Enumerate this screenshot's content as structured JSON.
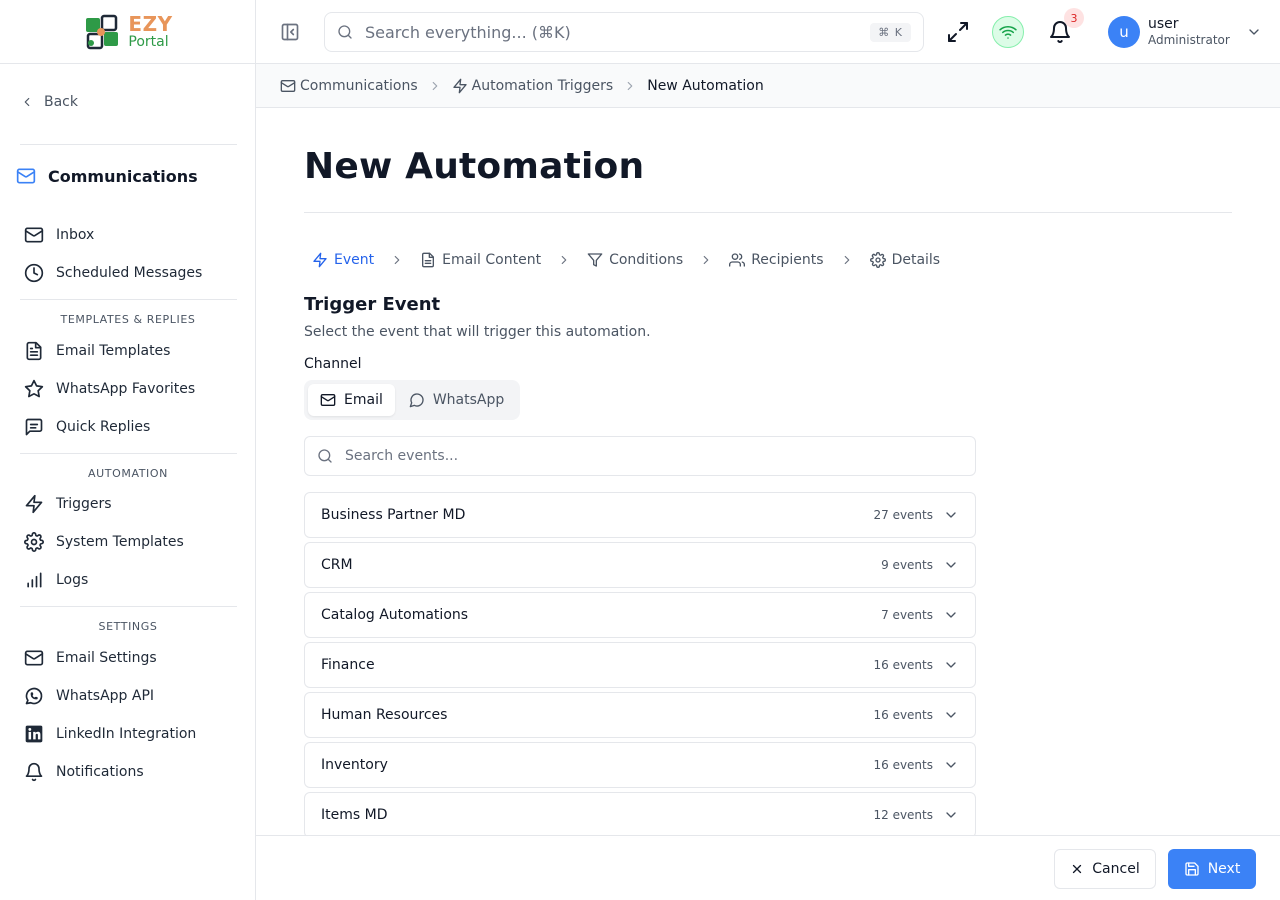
{
  "brand": {
    "name_top": "EZY",
    "name_bottom": "Portal"
  },
  "colors": {
    "accent": "#3b82f6",
    "active_step": "#2563eb",
    "logo_orange": "#e8955a",
    "logo_green": "#2e9a47",
    "status_green": "#22c55e",
    "badge_red": "#dc2626"
  },
  "sidebar": {
    "back_label": "Back",
    "section_title": "Communications",
    "items": [
      {
        "label": "Inbox",
        "icon": "mail-icon"
      },
      {
        "label": "Scheduled Messages",
        "icon": "clock-icon"
      }
    ],
    "groups": [
      {
        "label": "TEMPLATES & REPLIES",
        "items": [
          {
            "label": "Email Templates",
            "icon": "file-text-icon"
          },
          {
            "label": "WhatsApp Favorites",
            "icon": "star-icon"
          },
          {
            "label": "Quick Replies",
            "icon": "message-square-icon"
          }
        ]
      },
      {
        "label": "AUTOMATION",
        "items": [
          {
            "label": "Triggers",
            "icon": "zap-icon"
          },
          {
            "label": "System Templates",
            "icon": "gear-icon"
          },
          {
            "label": "Logs",
            "icon": "bar-chart-icon"
          }
        ]
      },
      {
        "label": "SETTINGS",
        "items": [
          {
            "label": "Email Settings",
            "icon": "mail-icon"
          },
          {
            "label": "WhatsApp API",
            "icon": "whatsapp-icon"
          },
          {
            "label": "LinkedIn Integration",
            "icon": "linkedin-icon"
          },
          {
            "label": "Notifications",
            "icon": "bell-icon"
          }
        ]
      }
    ]
  },
  "header": {
    "search_placeholder": "Search everything... (⌘K)",
    "search_shortcut": "⌘ K",
    "notification_count": "3",
    "user": {
      "initial": "u",
      "name": "user",
      "role": "Administrator"
    }
  },
  "breadcrumb": [
    {
      "label": "Communications",
      "icon": "mail-icon"
    },
    {
      "label": "Automation Triggers",
      "icon": "zap-icon"
    },
    {
      "label": "New Automation"
    }
  ],
  "page": {
    "title": "New Automation",
    "steps": [
      {
        "label": "Event",
        "icon": "zap-icon",
        "active": true
      },
      {
        "label": "Email Content",
        "icon": "file-text-icon"
      },
      {
        "label": "Conditions",
        "icon": "filter-icon"
      },
      {
        "label": "Recipients",
        "icon": "users-icon"
      },
      {
        "label": "Details",
        "icon": "gear-icon"
      }
    ],
    "section_title": "Trigger Event",
    "section_desc": "Select the event that will trigger this automation.",
    "channel_label": "Channel",
    "channels": [
      {
        "label": "Email",
        "icon": "mail-icon",
        "active": true
      },
      {
        "label": "WhatsApp",
        "icon": "message-circle-icon"
      }
    ],
    "event_search_placeholder": "Search events...",
    "event_groups": [
      {
        "name": "Business Partner MD",
        "count": "27 events"
      },
      {
        "name": "CRM",
        "count": "9 events"
      },
      {
        "name": "Catalog Automations",
        "count": "7 events"
      },
      {
        "name": "Finance",
        "count": "16 events"
      },
      {
        "name": "Human Resources",
        "count": "16 events"
      },
      {
        "name": "Inventory",
        "count": "16 events"
      },
      {
        "name": "Items MD",
        "count": "12 events"
      }
    ]
  },
  "footer": {
    "cancel_label": "Cancel",
    "next_label": "Next"
  }
}
